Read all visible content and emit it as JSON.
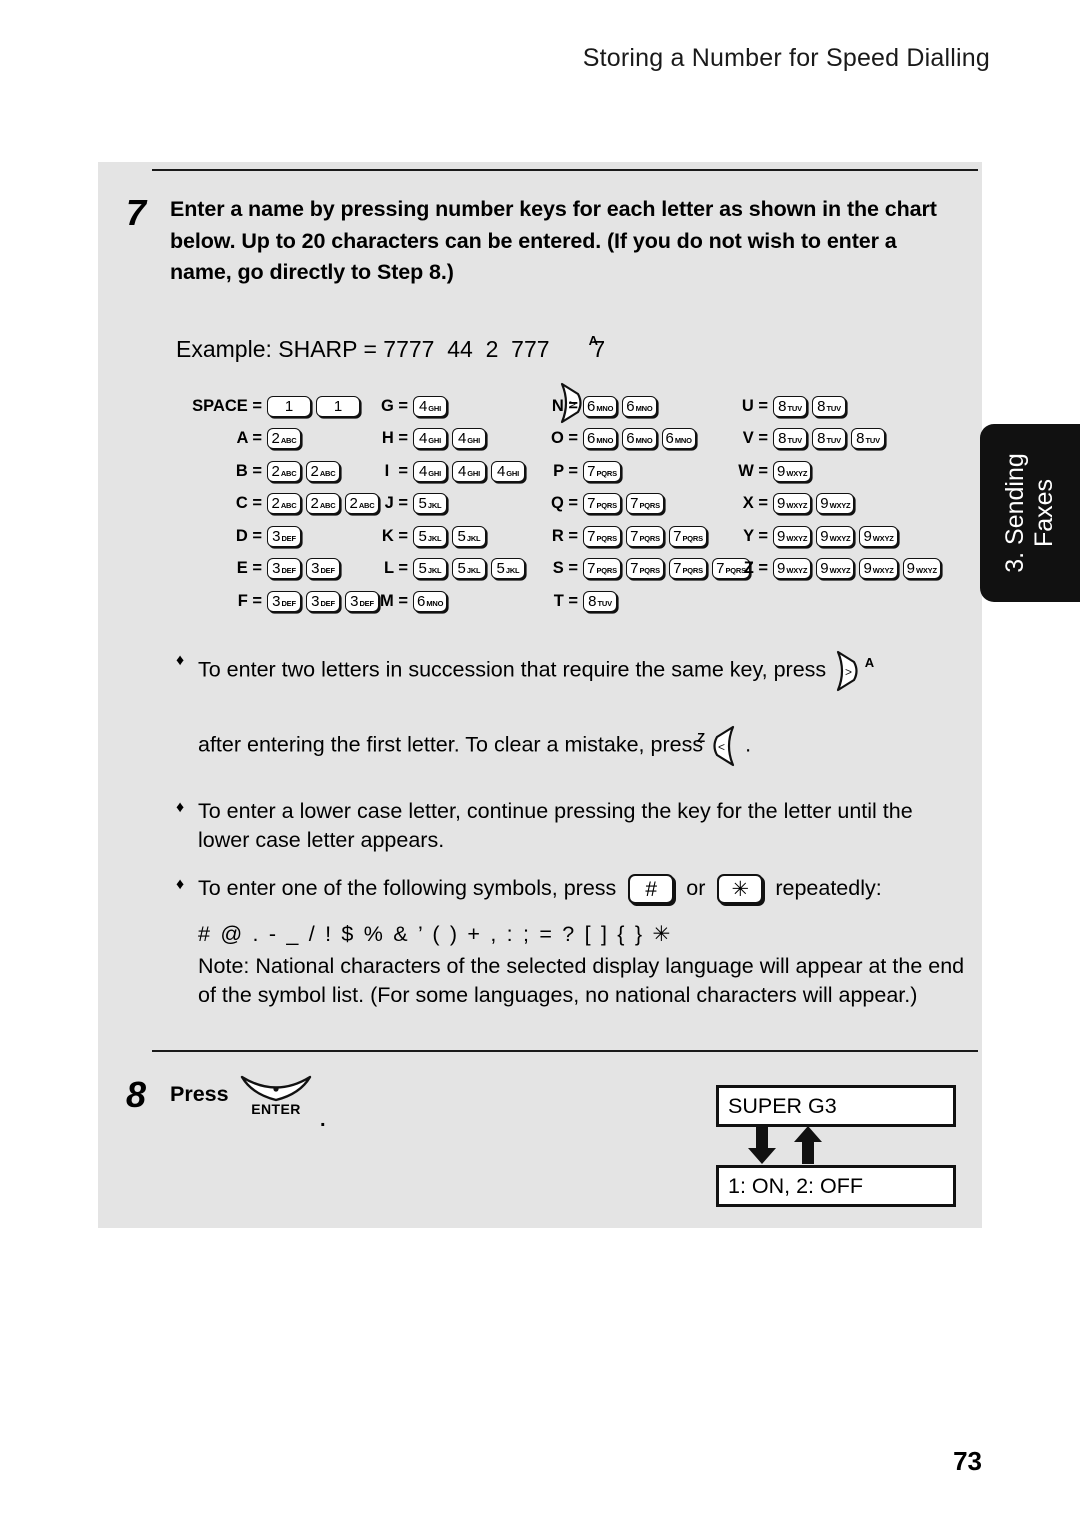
{
  "header": {
    "running_title": "Storing a Number for Speed Dialling"
  },
  "side_tab": {
    "line1": "3. Sending",
    "line2": "Faxes"
  },
  "page_number": "73",
  "step7": {
    "number": "7",
    "text": "Enter a name by pressing number keys for each letter as shown in the chart below. Up to 20 characters can be entered. (If you do not wish to enter a name, go directly to Step 8.)",
    "example_prefix": "Example: SHARP = 7777  44  2  777 ",
    "example_suffix": " 7",
    "example_key_sup": "A",
    "example_key_glyph": ">"
  },
  "chart": {
    "columns": [
      {
        "rows": [
          {
            "label": "SPACE =",
            "keys": [
              {
                "digit": "1",
                "letters": "",
                "wide": true
              },
              {
                "digit": "1",
                "letters": "",
                "wide": true
              }
            ]
          },
          {
            "label": "A =",
            "keys": [
              {
                "digit": "2",
                "letters": "ABC"
              }
            ]
          },
          {
            "label": "B =",
            "keys": [
              {
                "digit": "2",
                "letters": "ABC"
              },
              {
                "digit": "2",
                "letters": "ABC"
              }
            ]
          },
          {
            "label": "C =",
            "keys": [
              {
                "digit": "2",
                "letters": "ABC"
              },
              {
                "digit": "2",
                "letters": "ABC"
              },
              {
                "digit": "2",
                "letters": "ABC"
              }
            ]
          },
          {
            "label": "D =",
            "keys": [
              {
                "digit": "3",
                "letters": "DEF"
              }
            ]
          },
          {
            "label": "E =",
            "keys": [
              {
                "digit": "3",
                "letters": "DEF"
              },
              {
                "digit": "3",
                "letters": "DEF"
              }
            ]
          },
          {
            "label": "F =",
            "keys": [
              {
                "digit": "3",
                "letters": "DEF"
              },
              {
                "digit": "3",
                "letters": "DEF"
              },
              {
                "digit": "3",
                "letters": "DEF"
              }
            ]
          }
        ]
      },
      {
        "rows": [
          {
            "label": "G =",
            "keys": [
              {
                "digit": "4",
                "letters": "GHI"
              }
            ]
          },
          {
            "label": "H =",
            "keys": [
              {
                "digit": "4",
                "letters": "GHI"
              },
              {
                "digit": "4",
                "letters": "GHI"
              }
            ]
          },
          {
            "label": "I  =",
            "keys": [
              {
                "digit": "4",
                "letters": "GHI"
              },
              {
                "digit": "4",
                "letters": "GHI"
              },
              {
                "digit": "4",
                "letters": "GHI"
              }
            ]
          },
          {
            "label": "J =",
            "keys": [
              {
                "digit": "5",
                "letters": "JKL"
              }
            ]
          },
          {
            "label": "K =",
            "keys": [
              {
                "digit": "5",
                "letters": "JKL"
              },
              {
                "digit": "5",
                "letters": "JKL"
              }
            ]
          },
          {
            "label": "L =",
            "keys": [
              {
                "digit": "5",
                "letters": "JKL"
              },
              {
                "digit": "5",
                "letters": "JKL"
              },
              {
                "digit": "5",
                "letters": "JKL"
              }
            ]
          },
          {
            "label": "M =",
            "keys": [
              {
                "digit": "6",
                "letters": "MNO"
              }
            ]
          }
        ]
      },
      {
        "rows": [
          {
            "label": "N =",
            "keys": [
              {
                "digit": "6",
                "letters": "MNO"
              },
              {
                "digit": "6",
                "letters": "MNO"
              }
            ]
          },
          {
            "label": "O =",
            "keys": [
              {
                "digit": "6",
                "letters": "MNO"
              },
              {
                "digit": "6",
                "letters": "MNO"
              },
              {
                "digit": "6",
                "letters": "MNO"
              }
            ]
          },
          {
            "label": "P =",
            "keys": [
              {
                "digit": "7",
                "letters": "PQRS"
              }
            ]
          },
          {
            "label": "Q =",
            "keys": [
              {
                "digit": "7",
                "letters": "PQRS"
              },
              {
                "digit": "7",
                "letters": "PQRS"
              }
            ]
          },
          {
            "label": "R =",
            "keys": [
              {
                "digit": "7",
                "letters": "PQRS"
              },
              {
                "digit": "7",
                "letters": "PQRS"
              },
              {
                "digit": "7",
                "letters": "PQRS"
              }
            ]
          },
          {
            "label": "S =",
            "keys": [
              {
                "digit": "7",
                "letters": "PQRS"
              },
              {
                "digit": "7",
                "letters": "PQRS"
              },
              {
                "digit": "7",
                "letters": "PQRS"
              },
              {
                "digit": "7",
                "letters": "PQRS"
              }
            ]
          },
          {
            "label": "T =",
            "keys": [
              {
                "digit": "8",
                "letters": "TUV"
              }
            ]
          }
        ]
      },
      {
        "rows": [
          {
            "label": "U =",
            "keys": [
              {
                "digit": "8",
                "letters": "TUV"
              },
              {
                "digit": "8",
                "letters": "TUV"
              }
            ]
          },
          {
            "label": "V =",
            "keys": [
              {
                "digit": "8",
                "letters": "TUV"
              },
              {
                "digit": "8",
                "letters": "TUV"
              },
              {
                "digit": "8",
                "letters": "TUV"
              }
            ]
          },
          {
            "label": "W =",
            "keys": [
              {
                "digit": "9",
                "letters": "WXYZ"
              }
            ]
          },
          {
            "label": "X =",
            "keys": [
              {
                "digit": "9",
                "letters": "WXYZ"
              },
              {
                "digit": "9",
                "letters": "WXYZ"
              }
            ]
          },
          {
            "label": "Y =",
            "keys": [
              {
                "digit": "9",
                "letters": "WXYZ"
              },
              {
                "digit": "9",
                "letters": "WXYZ"
              },
              {
                "digit": "9",
                "letters": "WXYZ"
              }
            ]
          },
          {
            "label": "Z =",
            "keys": [
              {
                "digit": "9",
                "letters": "WXYZ"
              },
              {
                "digit": "9",
                "letters": "WXYZ"
              },
              {
                "digit": "9",
                "letters": "WXYZ"
              },
              {
                "digit": "9",
                "letters": "WXYZ"
              }
            ]
          }
        ]
      }
    ]
  },
  "bullets": {
    "b1_a": "To enter two letters in succession that require the same key, press",
    "b1_a_key_sup": "A",
    "b1_a_key_glyph": ">",
    "b1_b_pre": "after entering the first letter. To clear a mistake, press",
    "b1_b_key_sup": "Z",
    "b1_b_key_glyph": "<",
    "b1_b_post": ".",
    "b2": "To enter a lower case letter, continue pressing the key for the letter until the lower case letter appears.",
    "b3_pre": "To enter one of the following symbols, press",
    "b3_key_hash": "#",
    "b3_mid": "or",
    "b3_key_star": "✳",
    "b3_post": "repeatedly:",
    "symbol_list": "# @ . - _ / ! $ % & ’ ( ) + , : ; = ? [ ] { } ✳",
    "note": "Note: National characters of the selected display language will appear at the end of the symbol list. (For some languages, no national characters will appear.)",
    "diamond": "♦"
  },
  "step8": {
    "number": "8",
    "press_label": "Press",
    "enter_key_label": "ENTER",
    "trailing_dot": "."
  },
  "display": {
    "line1": "SUPER G3",
    "line2": "1: ON, 2: OFF"
  },
  "colors": {
    "panel_bg": "#e4e4e4",
    "ink": "#111111",
    "tab_bg": "#111111",
    "tab_text": "#ffffff"
  }
}
